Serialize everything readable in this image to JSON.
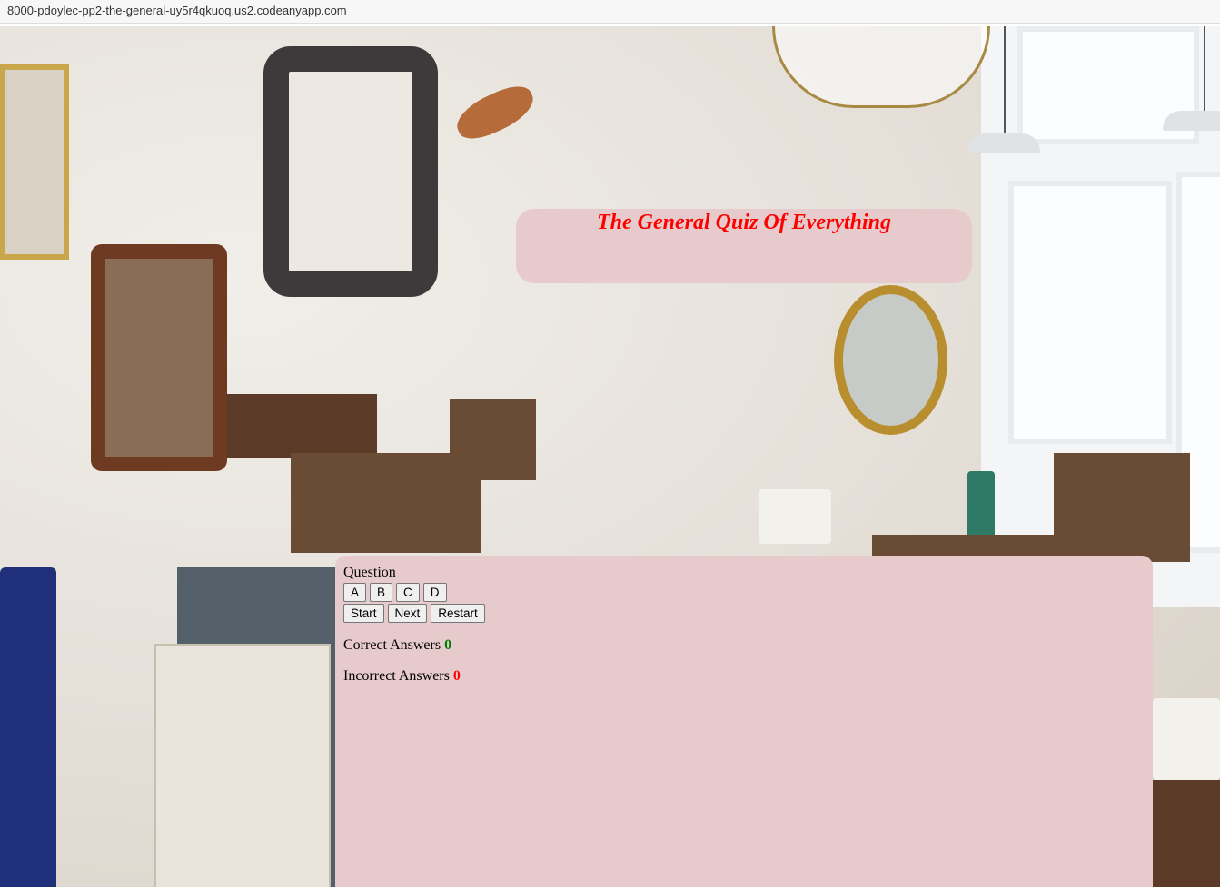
{
  "browser": {
    "url": "8000-pdoylec-pp2-the-general-uy5r4qkuoq.us2.codeanyapp.com"
  },
  "header": {
    "title": "The General Quiz Of Everything"
  },
  "quiz": {
    "question_label": "Question",
    "answers": [
      "A",
      "B",
      "C",
      "D"
    ],
    "controls": {
      "start": "Start",
      "next": "Next",
      "restart": "Restart"
    },
    "correct_label": "Correct Answers",
    "correct_count": "0",
    "incorrect_label": "Incorrect Answers",
    "incorrect_count": "0"
  },
  "colors": {
    "panel": "#e7cbcc",
    "title": "#ff0000",
    "correct": "#008000",
    "incorrect": "#ff0000"
  }
}
